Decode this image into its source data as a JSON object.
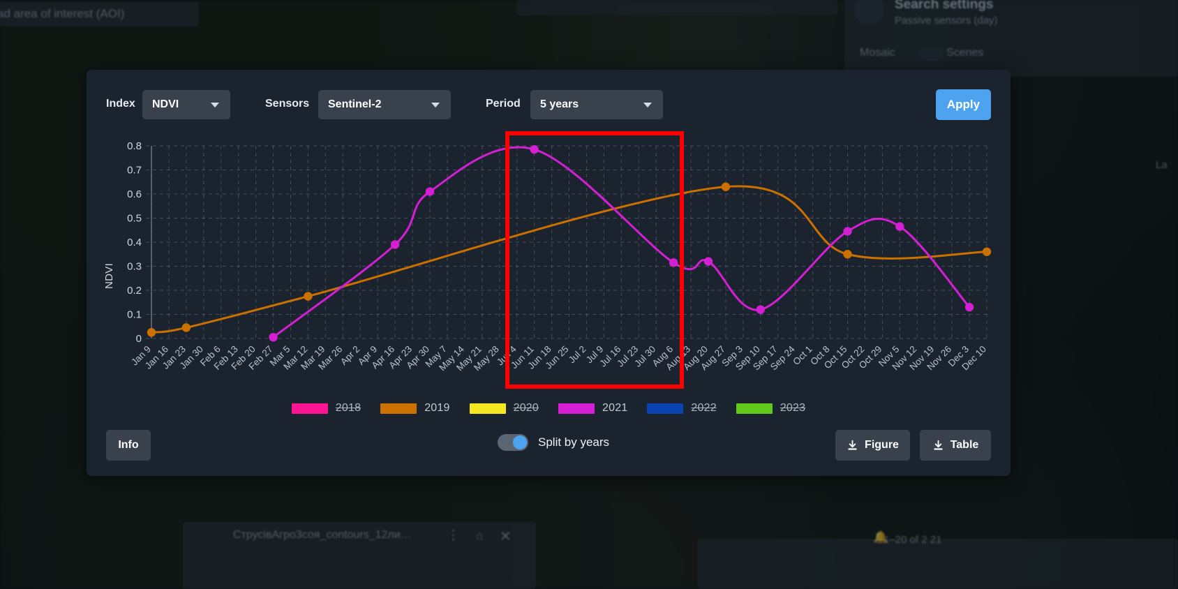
{
  "background": {
    "aoi_text": "ad area of interest (AOI)",
    "search_settings_title": "Search settings",
    "search_settings_subtitle": "Passive sensors (day)",
    "mosaic_label": "Mosaic",
    "scenes_label": "Scenes",
    "layer_name": "СтрусівАгро3соя_contours_12ли…",
    "pagination": "1–20 of 2 21",
    "corner_label": "La"
  },
  "toolbar": {
    "index_label": "Index",
    "index_value": "NDVI",
    "sensors_label": "Sensors",
    "sensors_value": "Sentinel-2",
    "period_label": "Period",
    "period_value": "5 years",
    "apply_label": "Apply"
  },
  "bottom": {
    "info_label": "Info",
    "split_label": "Split by years",
    "split_on": true,
    "figure_label": "Figure",
    "table_label": "Table"
  },
  "colors": {
    "accent": "#4da3ef",
    "card_bg": "#1b232e",
    "control_bg": "#39414d",
    "highlight_box": "#ff0000",
    "grid": "#8b95a1"
  },
  "chart_data": {
    "type": "line",
    "title": "",
    "xlabel": "",
    "ylabel": "NDVI",
    "ylim": [
      0,
      0.8
    ],
    "yticks": [
      0,
      0.1,
      0.2,
      0.3,
      0.4,
      0.5,
      0.6,
      0.7,
      0.8
    ],
    "ytick_labels": [
      "0",
      "0.1",
      "0.2",
      "0.3",
      "0.4",
      "0.5",
      "0.6",
      "0.7",
      "0.8"
    ],
    "grid": true,
    "legend_position": "bottom",
    "categories": [
      "Jan 9",
      "Jan 16",
      "Jan 23",
      "Jan 30",
      "Feb 6",
      "Feb 13",
      "Feb 20",
      "Feb 27",
      "Mar 5",
      "Mar 12",
      "Mar 19",
      "Mar 26",
      "Apr 2",
      "Apr 9",
      "Apr 16",
      "Apr 23",
      "Apr 30",
      "May 7",
      "May 14",
      "May 21",
      "May 28",
      "Jun 4",
      "Jun 11",
      "Jun 18",
      "Jun 25",
      "Jul 2",
      "Jul 9",
      "Jul 16",
      "Jul 23",
      "Jul 30",
      "Aug 6",
      "Aug 13",
      "Aug 20",
      "Aug 27",
      "Sep 3",
      "Sep 10",
      "Sep 17",
      "Sep 24",
      "Oct 1",
      "Oct 8",
      "Oct 15",
      "Oct 22",
      "Oct 29",
      "Nov 5",
      "Nov 12",
      "Nov 19",
      "Nov 26",
      "Dec 3",
      "Dec 10"
    ],
    "series": [
      {
        "name": "2018",
        "color": "#ff1493",
        "visible": false,
        "points": []
      },
      {
        "name": "2019",
        "color": "#cc7000",
        "visible": true,
        "points": [
          {
            "x": "Jan 9",
            "y": 0.025
          },
          {
            "x": "Jan 23",
            "y": 0.045
          },
          {
            "x": "Mar 12",
            "y": 0.175
          },
          {
            "x": "Aug 27",
            "y": 0.63
          },
          {
            "x": "Oct 15",
            "y": 0.35
          },
          {
            "x": "Dec 10",
            "y": 0.36
          }
        ]
      },
      {
        "name": "2020",
        "color": "#f5e821",
        "visible": false,
        "points": []
      },
      {
        "name": "2021",
        "color": "#d51fd5",
        "visible": true,
        "points": [
          {
            "x": "Feb 27",
            "y": 0.005
          },
          {
            "x": "Apr 16",
            "y": 0.39
          },
          {
            "x": "Apr 30",
            "y": 0.61
          },
          {
            "x": "Jun 11",
            "y": 0.785
          },
          {
            "x": "Aug 6",
            "y": 0.315
          },
          {
            "x": "Aug 20",
            "y": 0.32
          },
          {
            "x": "Sep 10",
            "y": 0.12
          },
          {
            "x": "Oct 15",
            "y": 0.445
          },
          {
            "x": "Nov 5",
            "y": 0.465
          },
          {
            "x": "Dec 3",
            "y": 0.13
          }
        ]
      },
      {
        "name": "2022",
        "color": "#0b43b3",
        "visible": false,
        "points": []
      },
      {
        "name": "2023",
        "color": "#62c91a",
        "visible": false,
        "points": []
      }
    ],
    "annotations": [
      {
        "type": "rect",
        "name": "highlight-box",
        "color": "#ff0000",
        "x_start": "Jun 11",
        "x_end": "Aug 20"
      }
    ]
  }
}
